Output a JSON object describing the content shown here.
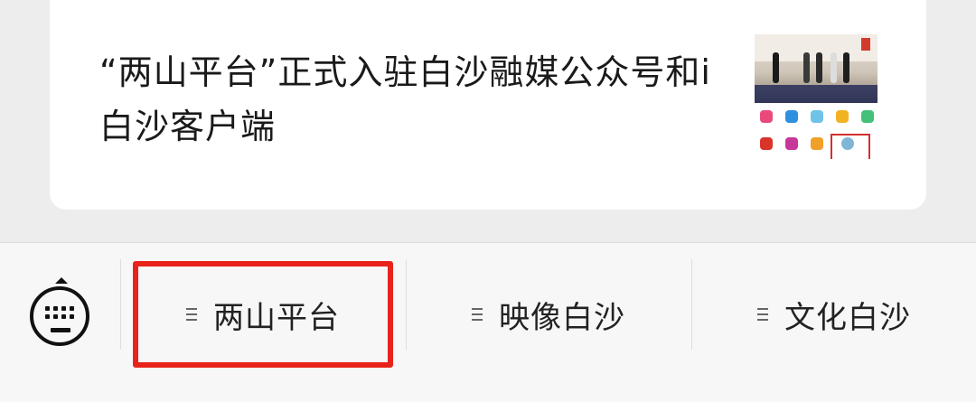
{
  "article": {
    "title": "“两山平台”正式入驻白沙融媒公众号和i白沙客户端",
    "thumbnail_icon": "article-thumbnail-image"
  },
  "bottom_menu": {
    "keyboard_icon": "keyboard-icon",
    "menu_icon": "menu-lines-icon",
    "items": [
      {
        "label": "两山平台",
        "highlighted": true
      },
      {
        "label": "映像白沙",
        "highlighted": false
      },
      {
        "label": "文化白沙",
        "highlighted": false
      }
    ],
    "highlight_color": "#e8231b"
  }
}
